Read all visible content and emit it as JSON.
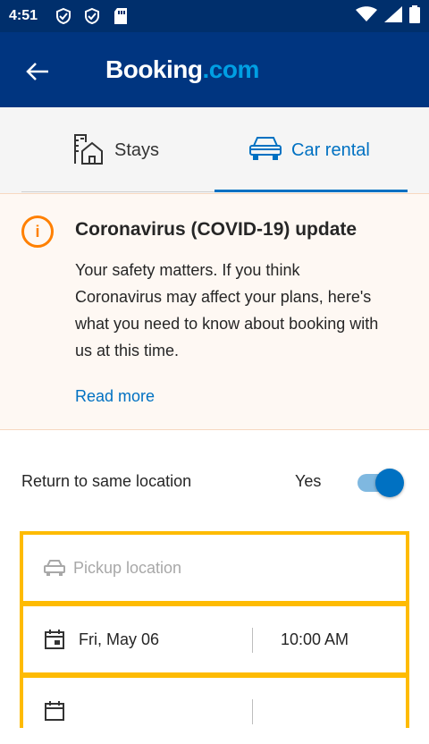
{
  "status": {
    "time": "4:51",
    "icons": [
      "shield-check-icon",
      "shield-check-icon",
      "sd-card-icon"
    ],
    "right_icons": [
      "wifi-icon",
      "cell-signal-icon",
      "battery-icon"
    ]
  },
  "appbar": {
    "back_icon": "back-arrow-icon",
    "logo_main": "Booking",
    "logo_dot": ".com"
  },
  "tabs": [
    {
      "label": "Stays",
      "icon": "building-icon"
    },
    {
      "label": "Car rental",
      "icon": "car-icon",
      "active": true
    }
  ],
  "notice": {
    "icon": "info-icon",
    "icon_text": "i",
    "title": "Coronavirus (COVID-19) update",
    "body": "Your safety matters. If you think Coronavirus may affect your plans, here's what you need to know about booking with us at this time.",
    "link": "Read more"
  },
  "return_option": {
    "label": "Return to same location",
    "value_label": "Yes",
    "enabled": true
  },
  "form": {
    "pickup_placeholder": "Pickup location",
    "pickup_date": "Fri, May 06",
    "pickup_time": "10:00 AM"
  },
  "colors": {
    "brand_dark": "#003580",
    "status_bar": "#002f6c",
    "accent": "#0071c2",
    "form_border": "#febb02",
    "warning": "#ff8000"
  }
}
